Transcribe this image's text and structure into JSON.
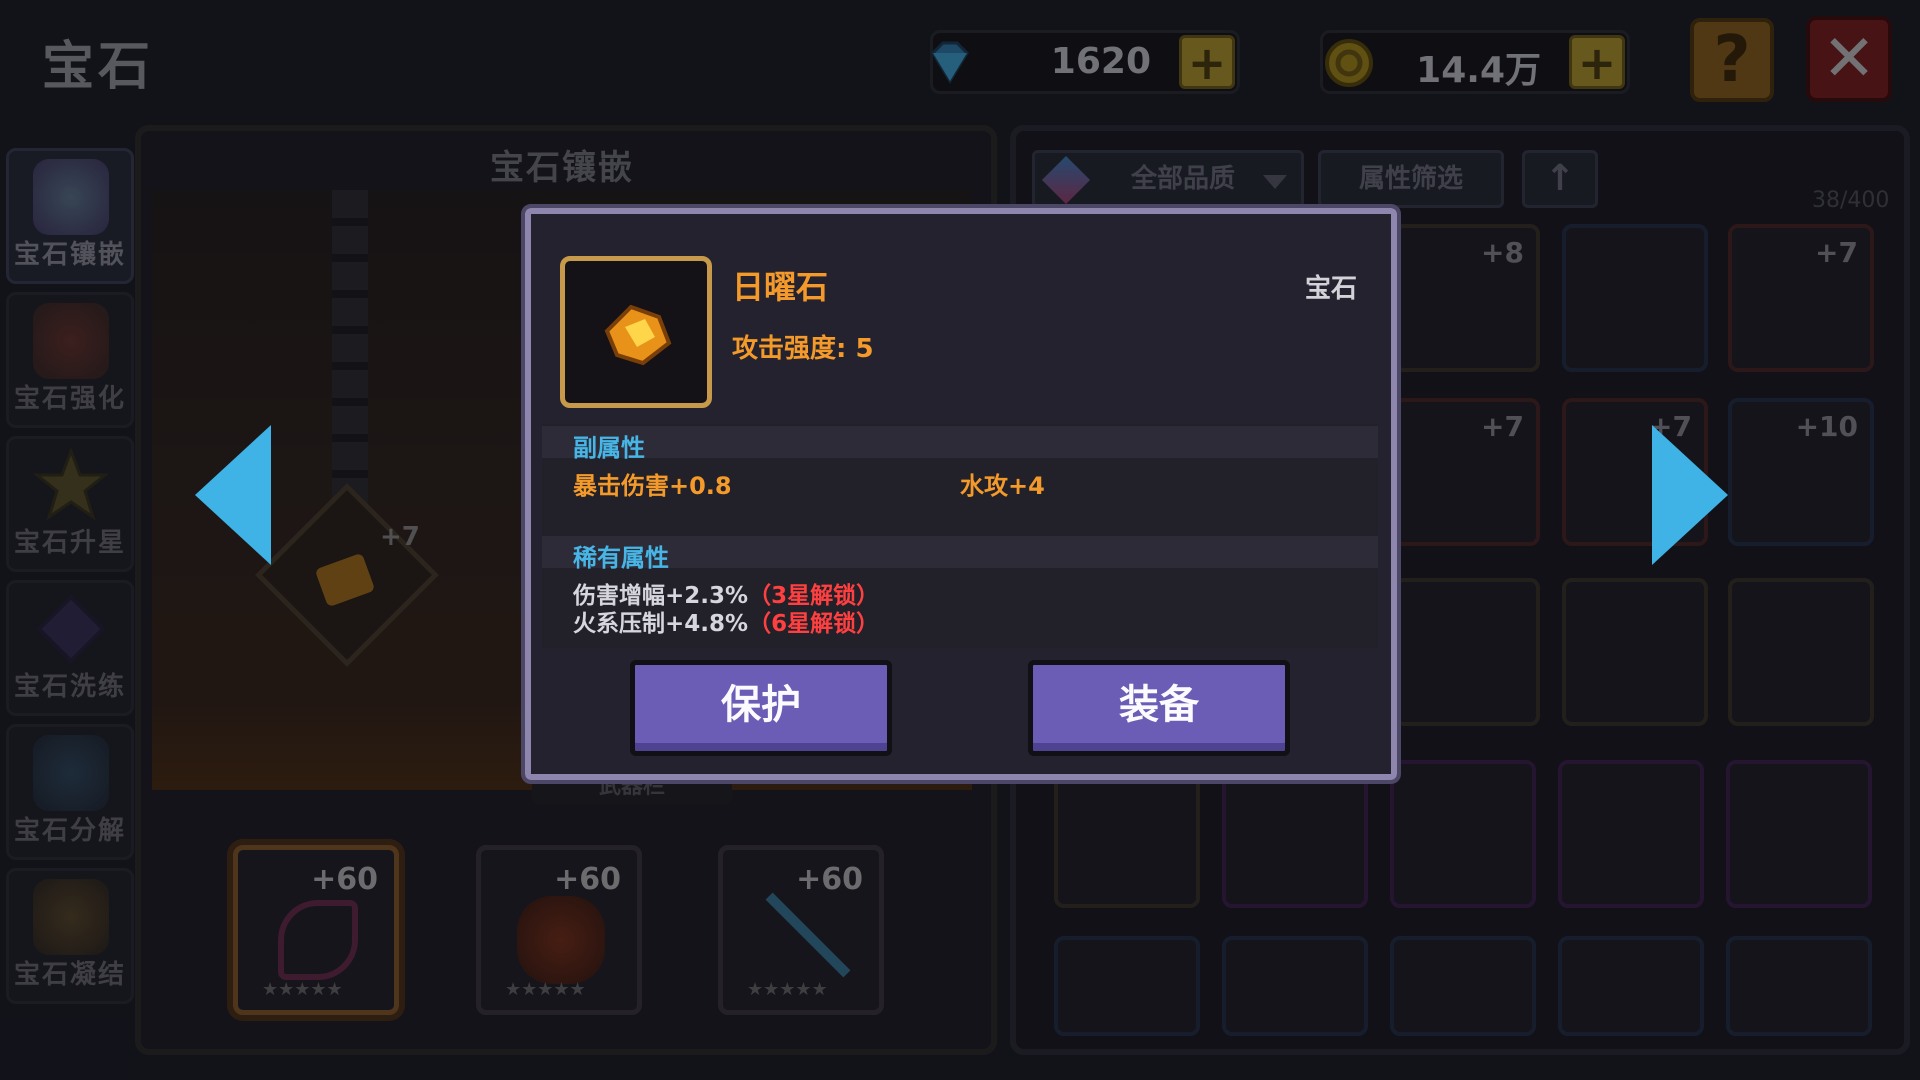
{
  "header": {
    "title": "宝石",
    "diamonds": "1620",
    "coins": "14.4万",
    "help_label": "?",
    "close_label": "✕"
  },
  "sidebar": {
    "items": [
      {
        "label": "宝石镶嵌",
        "icon": "gem-inlay-icon",
        "active": true
      },
      {
        "label": "宝石强化",
        "icon": "gem-enhance-icon",
        "active": false
      },
      {
        "label": "宝石升星",
        "icon": "star-icon",
        "active": false
      },
      {
        "label": "宝石洗练",
        "icon": "gem-refine-icon",
        "active": false
      },
      {
        "label": "宝石分解",
        "icon": "gem-decompose-icon",
        "active": false
      },
      {
        "label": "宝石凝结",
        "icon": "gem-condense-icon",
        "active": false
      }
    ]
  },
  "inlay": {
    "title": "宝石镶嵌",
    "socket_plus": "+7",
    "weapon_bar_label": "武器栏",
    "equip_slots": [
      {
        "plus": "+60",
        "icon": "scythe-icon"
      },
      {
        "plus": "+60",
        "icon": "armor-icon"
      },
      {
        "plus": "+60",
        "icon": "spear-icon"
      }
    ]
  },
  "inventory": {
    "quality_filter": "全部品质",
    "attr_filter": "属性筛选",
    "count": "38/400",
    "visible_plus_labels": [
      "+8",
      "+7",
      "+7",
      "+7",
      "+10"
    ]
  },
  "dialog": {
    "item_name": "日曜石",
    "item_type": "宝石",
    "main_stat": "攻击强度: 5",
    "sub_attr_title": "副属性",
    "sub_attrs": [
      "暴击伤害+0.8",
      "水攻+4"
    ],
    "rare_attr_title": "稀有属性",
    "rare_attrs": [
      {
        "text": "伤害增幅+2.3%",
        "lock": "（3星解锁）"
      },
      {
        "text": "火系压制+4.8%",
        "lock": "（6星解锁）"
      }
    ],
    "protect_button": "保护",
    "equip_button": "装备"
  },
  "colors": {
    "accent_orange": "#f49a2a",
    "section_blue": "#47b6e6",
    "lock_red": "#ff4040",
    "button_purple": "#6b5db5",
    "arrow_blue": "#3fb2e6"
  }
}
